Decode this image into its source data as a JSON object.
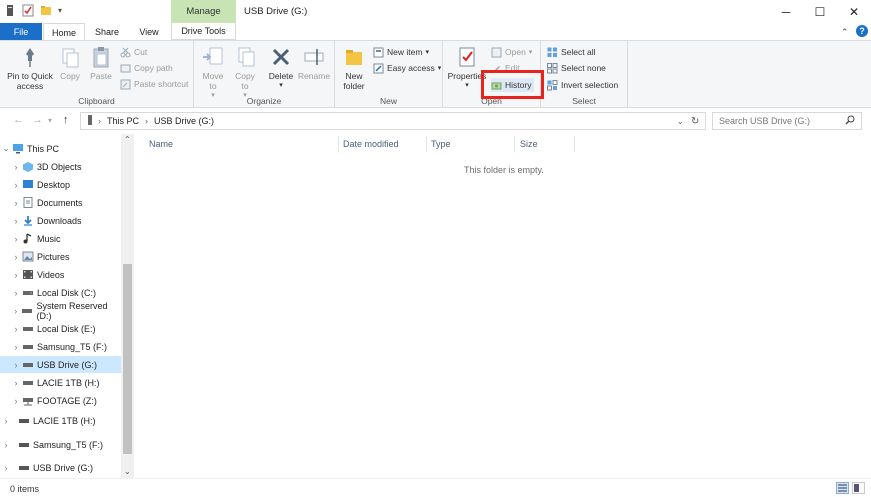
{
  "window": {
    "title": "USB Drive (G:)",
    "context_tab": "Manage",
    "minimize": "─",
    "maximize": "☐",
    "close": "✕"
  },
  "tabs": {
    "file": "File",
    "home": "Home",
    "share": "Share",
    "view": "View",
    "drive_tools": "Drive Tools"
  },
  "ribbon": {
    "clipboard": {
      "label": "Clipboard",
      "pin": "Pin to Quick access",
      "copy": "Copy",
      "paste": "Paste",
      "cut": "Cut",
      "copy_path": "Copy path",
      "paste_shortcut": "Paste shortcut"
    },
    "organize": {
      "label": "Organize",
      "move_to": "Move to",
      "copy_to": "Copy to",
      "delete": "Delete",
      "rename": "Rename"
    },
    "new": {
      "label": "New",
      "new_folder": "New folder",
      "new_item": "New item",
      "easy_access": "Easy access"
    },
    "open": {
      "label": "Open",
      "properties": "Properties",
      "open": "Open",
      "edit": "Edit",
      "history": "History"
    },
    "select": {
      "label": "Select",
      "select_all": "Select all",
      "select_none": "Select none",
      "invert": "Invert selection"
    }
  },
  "address": {
    "crumbs": [
      "This PC",
      "USB Drive (G:)"
    ],
    "search_placeholder": "Search USB Drive (G:)"
  },
  "nav": {
    "items": [
      {
        "label": "This PC"
      },
      {
        "label": "3D Objects"
      },
      {
        "label": "Desktop"
      },
      {
        "label": "Documents"
      },
      {
        "label": "Downloads"
      },
      {
        "label": "Music"
      },
      {
        "label": "Pictures"
      },
      {
        "label": "Videos"
      },
      {
        "label": "Local Disk (C:)"
      },
      {
        "label": "System Reserved (D:)"
      },
      {
        "label": "Local Disk (E:)"
      },
      {
        "label": "Samsung_T5 (F:)"
      },
      {
        "label": "USB Drive (G:)"
      },
      {
        "label": "LACIE 1TB (H:)"
      },
      {
        "label": "FOOTAGE (Z:)"
      },
      {
        "label": "LACIE 1TB (H:)"
      },
      {
        "label": "Samsung_T5 (F:)"
      },
      {
        "label": "USB Drive (G:)"
      }
    ]
  },
  "columns": [
    "Name",
    "Date modified",
    "Type",
    "Size"
  ],
  "content": {
    "empty_message": "This folder is empty."
  },
  "status": {
    "count": "0 items"
  },
  "colors": {
    "accent": "#1a6fc8",
    "manage_tab": "#c9e4b4",
    "selection": "#cce8ff",
    "highlight": "#e8231c"
  }
}
